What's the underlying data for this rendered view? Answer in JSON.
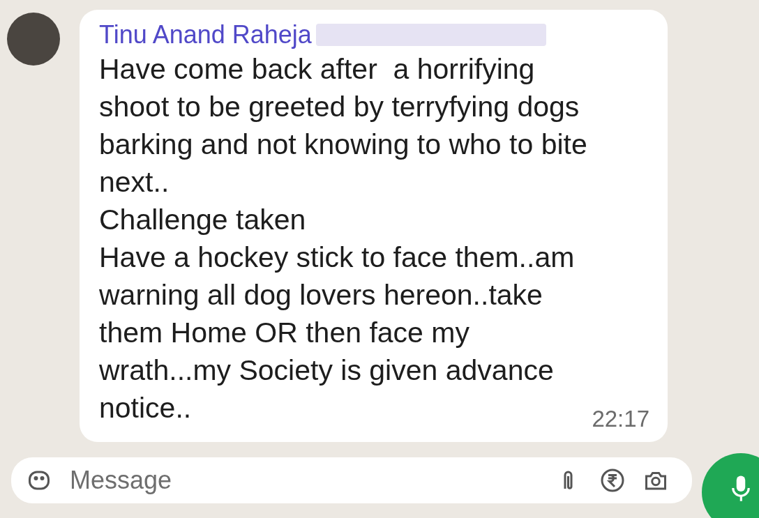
{
  "message": {
    "sender": "Tinu Anand Raheja",
    "lines": [
      "Have come back after  a horrifying",
      "shoot to be greeted by terryfying dogs",
      "barking and not knowing to who to bite",
      "next..",
      "Challenge taken",
      "Have a hockey stick to face them..am",
      "warning all dog lovers hereon..take",
      "them Home OR then face my",
      "wrath...my Society is given advance",
      "notice.."
    ],
    "time": "22:17"
  },
  "composer": {
    "placeholder": "Message"
  }
}
